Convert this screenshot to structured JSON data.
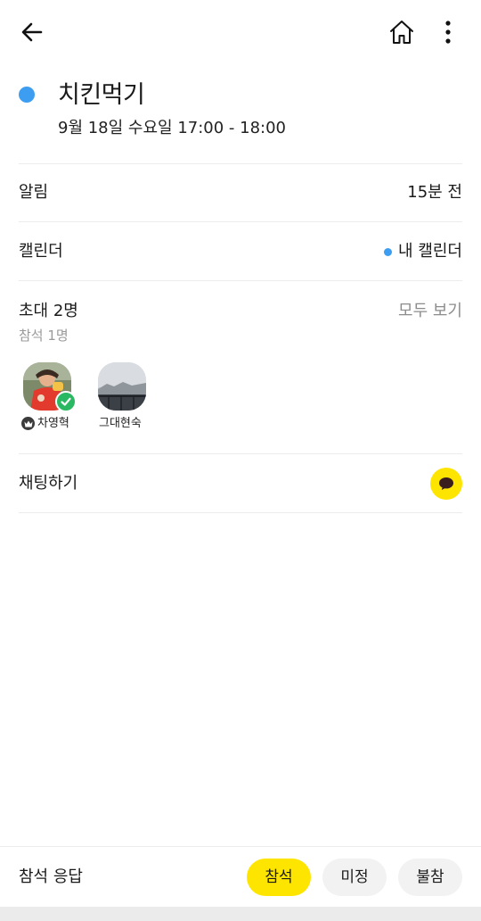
{
  "event": {
    "title": "치킨먹기",
    "datetime": "9월 18일 수요일  17:00 - 18:00",
    "color": "#3d9ef1"
  },
  "alarm": {
    "label": "알림",
    "value": "15분 전"
  },
  "calendar": {
    "label": "캘린더",
    "value": "내 캘린더",
    "dot_color": "#3d9ef1"
  },
  "invite": {
    "label": "초대 2명",
    "attending": "참석 1명",
    "see_all": "모두 보기",
    "people": [
      {
        "name": "차영혁",
        "is_host": true,
        "attending": true
      },
      {
        "name": "그대현숙",
        "is_host": false,
        "attending": false
      }
    ]
  },
  "chat": {
    "label": "채팅하기",
    "accent": "#fee500"
  },
  "rsvp": {
    "label": "참석 응답",
    "yes": "참석",
    "maybe": "미정",
    "no": "불참",
    "selected": "참석"
  },
  "icons": {
    "back": "arrow-left-icon",
    "home": "home-icon",
    "more": "more-vertical-icon",
    "chat": "chat-bubble-icon",
    "host": "crown-icon",
    "check": "check-icon"
  }
}
